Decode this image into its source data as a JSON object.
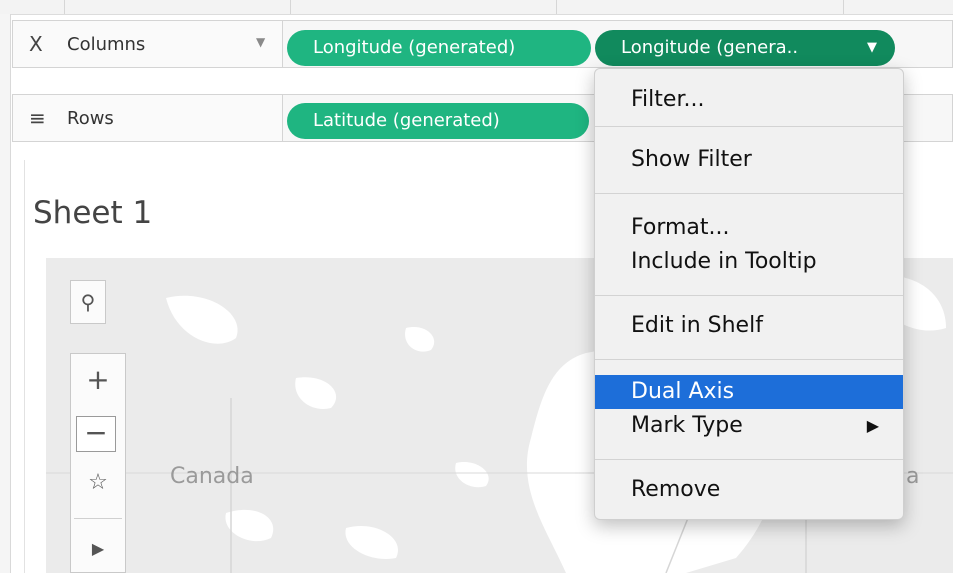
{
  "shelves": {
    "columns": {
      "label": "Columns",
      "icon": "columns-icon"
    },
    "rows": {
      "label": "Rows",
      "icon": "rows-icon"
    }
  },
  "pills": {
    "col1": "Longitude (generated)",
    "col2": "Longitude (genera..",
    "row1": "Latitude (generated)"
  },
  "sheet": {
    "title": "Sheet 1"
  },
  "map": {
    "labels": [
      "Canada",
      "a"
    ]
  },
  "context_menu": {
    "items": [
      "Filter...",
      "Show Filter",
      "Format...",
      "Include in Tooltip",
      "Edit in Shelf",
      "Dual Axis",
      "Mark Type",
      "Remove"
    ],
    "selected": "Dual Axis"
  },
  "colors": {
    "pill_green": "#1fb581",
    "pill_dark": "#118a5d",
    "menu_highlight": "#1d6ed9"
  }
}
